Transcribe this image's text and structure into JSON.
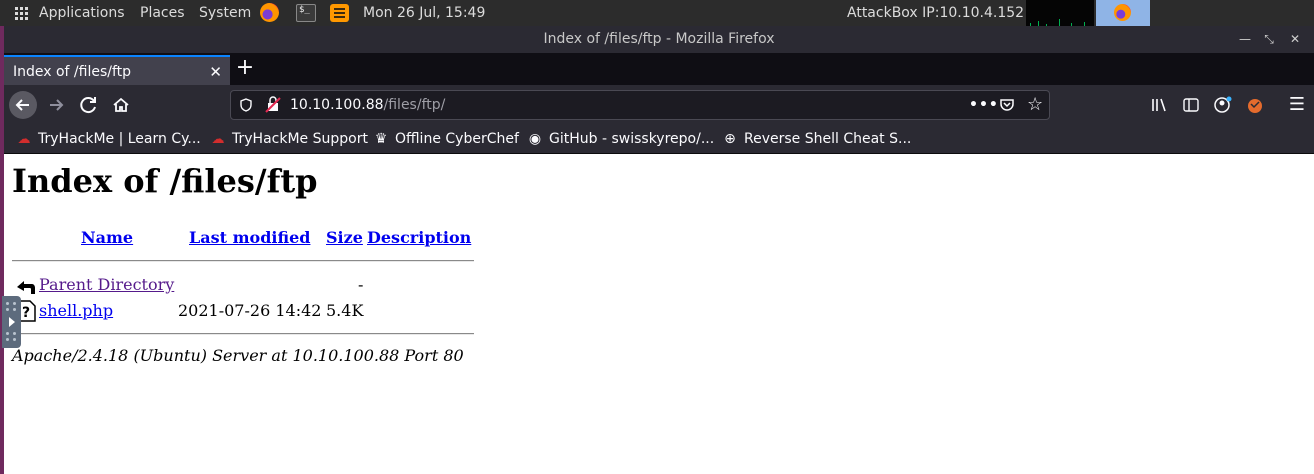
{
  "panel": {
    "applications": "Applications",
    "places": "Places",
    "system": "System",
    "clock": "Mon 26 Jul, 15:49",
    "attackbox_ip": "AttackBox IP:10.10.4.152",
    "terminal_glyph": "$_"
  },
  "window": {
    "title": "Index of /files/ftp - Mozilla Firefox"
  },
  "tab": {
    "title": "Index of /files/ftp",
    "close": "✕",
    "new_tab": "+"
  },
  "urlbar": {
    "host": "10.10.100.88",
    "path": "/files/ftp/"
  },
  "bookmarks": [
    {
      "label": "TryHackMe | Learn Cy...",
      "icon": "tryhackme-icon"
    },
    {
      "label": "TryHackMe Support",
      "icon": "tryhackme-icon"
    },
    {
      "label": "Offline CyberChef",
      "icon": "chef-hat-icon"
    },
    {
      "label": "GitHub - swisskyrepo/...",
      "icon": "github-icon"
    },
    {
      "label": "Reverse Shell Cheat S...",
      "icon": "globe-icon"
    }
  ],
  "page": {
    "heading": "Index of /files/ftp",
    "columns": {
      "name": "Name",
      "last_modified": "Last modified",
      "size": "Size",
      "description": "Description"
    },
    "rows": [
      {
        "name": "Parent Directory",
        "modified": "",
        "size": "-",
        "description": "",
        "icon": "back-arrow-icon"
      },
      {
        "name": "shell.php",
        "modified": "2021-07-26 14:42",
        "size": "5.4K",
        "description": "",
        "icon": "unknown-file-icon"
      }
    ],
    "address": "Apache/2.4.18 (Ubuntu) Server at 10.10.100.88 Port 80"
  },
  "colors": {
    "link": "#0000ee",
    "visited_link": "#551a8b",
    "toolbar": "#2b2a33",
    "tab_accent": "#0a84ff"
  }
}
